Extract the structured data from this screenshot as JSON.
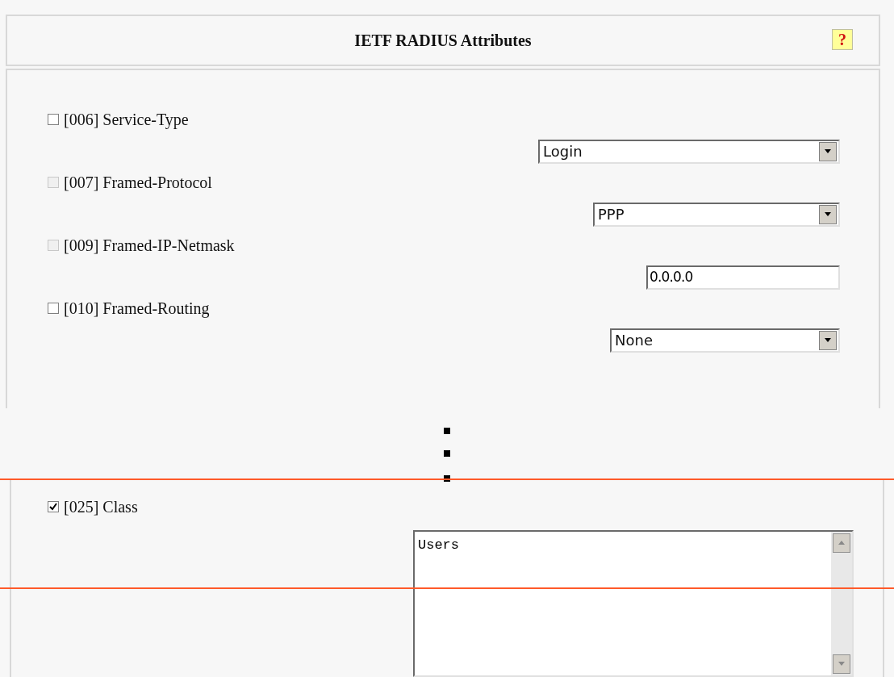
{
  "header": {
    "title": "IETF RADIUS Attributes",
    "help_icon": "?"
  },
  "attributes": [
    {
      "label": "[006] Service-Type",
      "checked": false,
      "disabled": false,
      "kind": "select",
      "value": "Login"
    },
    {
      "label": "[007] Framed-Protocol",
      "checked": false,
      "disabled": true,
      "kind": "select",
      "value": "PPP"
    },
    {
      "label": "[009] Framed-IP-Netmask",
      "checked": false,
      "disabled": true,
      "kind": "text",
      "value": "0.0.0.0"
    },
    {
      "label": "[010] Framed-Routing",
      "checked": false,
      "disabled": false,
      "kind": "select",
      "value": "None"
    }
  ],
  "more_attributes": [
    {
      "label": "[025] Class",
      "checked": true,
      "disabled": false,
      "kind": "textarea",
      "value": "Users"
    }
  ]
}
